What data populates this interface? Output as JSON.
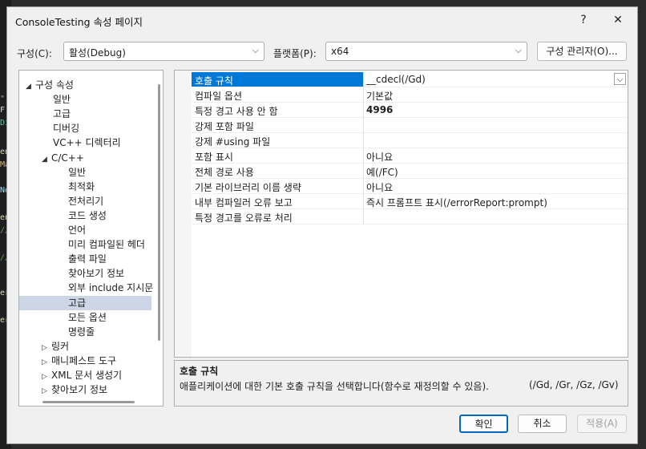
{
  "window": {
    "title": "ConsoleTesting 속성 페이지",
    "help_label": "?",
    "close_label": "✕"
  },
  "config": {
    "config_label": "구성(C):",
    "config_value": "활성(Debug)",
    "platform_label": "플랫폼(P):",
    "platform_value": "x64",
    "manager_label": "구성 관리자(O)..."
  },
  "tree": {
    "items": [
      {
        "label": "구성 속성",
        "expander": "◢"
      },
      {
        "label": "일반"
      },
      {
        "label": "고급"
      },
      {
        "label": "디버깅"
      },
      {
        "label": "VC++ 디렉터리"
      },
      {
        "label": "C/C++",
        "expander": "◢"
      },
      {
        "label": "일반"
      },
      {
        "label": "최적화"
      },
      {
        "label": "전처리기"
      },
      {
        "label": "코드 생성"
      },
      {
        "label": "언어"
      },
      {
        "label": "미리 컴파일된 헤더"
      },
      {
        "label": "출력 파일"
      },
      {
        "label": "찾아보기 정보"
      },
      {
        "label": "외부 include 지시문"
      },
      {
        "label": "고급",
        "selected": true
      },
      {
        "label": "모든 옵션"
      },
      {
        "label": "명령줄"
      },
      {
        "label": "링커",
        "expander": "▷"
      },
      {
        "label": "매니페스트 도구",
        "expander": "▷"
      },
      {
        "label": "XML 문서 생성기",
        "expander": "▷"
      },
      {
        "label": "찾아보기 정보",
        "expander": "▷"
      }
    ]
  },
  "grid": {
    "rows": [
      {
        "name": "호출 규칙",
        "value": "__cdecl(/Gd)",
        "selected": true,
        "bold": false
      },
      {
        "name": "컴파일 옵션",
        "value": "기본값",
        "bold": false
      },
      {
        "name": "특정 경고 사용 안 함",
        "value": "4996",
        "bold": true
      },
      {
        "name": "강제 포함 파일",
        "value": "",
        "bold": false
      },
      {
        "name": "강제 #using 파일",
        "value": "",
        "bold": false
      },
      {
        "name": "포함 표시",
        "value": "아니요",
        "bold": false
      },
      {
        "name": "전체 경로 사용",
        "value": "예(/FC)",
        "bold": false
      },
      {
        "name": "기본 라이브러리 이름 생략",
        "value": "아니요",
        "bold": false
      },
      {
        "name": "내부 컴파일러 오류 보고",
        "value": "즉시 프롬프트 표시(/errorReport:prompt)",
        "bold": false
      },
      {
        "name": "특정 경고를 오류로 처리",
        "value": "",
        "bold": false
      }
    ]
  },
  "description": {
    "title": "호출 규칙",
    "text": "애플리케이션에 대한 기본 호출 규칙을 선택합니다(함수로 재정의할 수 있음).",
    "options": "(/Gd, /Gr, /Gz, /Gv)"
  },
  "buttons": {
    "ok": "확인",
    "cancel": "취소",
    "apply": "적용(A)"
  },
  "colors": {
    "selection_blue": "#0078d7",
    "tree_selection": "#ccd6e4",
    "ok_border": "#0067c0",
    "disabled_text": "#a0a0a0"
  },
  "background_code": {
    "lines": [
      {
        "text": "\";",
        "color": "#d69d85"
      },
      {
        "text": "F",
        "color": "#dcdcdc"
      },
      {
        "text": "Di",
        "color": "#4ec9b0"
      },
      {
        "text": "en",
        "color": "#dcdcaa"
      },
      {
        "text": "Ma",
        "color": "#d7ba7d"
      },
      {
        "text": "No",
        "color": "#9cdcfe"
      },
      {
        "text": "en",
        "color": "#dcdcaa"
      },
      {
        "text": "//",
        "color": "#57a64a"
      },
      {
        "text": "//",
        "color": "#57a64a"
      },
      {
        "text": "er",
        "color": "#dcdcaa"
      },
      {
        "text": "er",
        "color": "#dcdcaa"
      }
    ]
  }
}
